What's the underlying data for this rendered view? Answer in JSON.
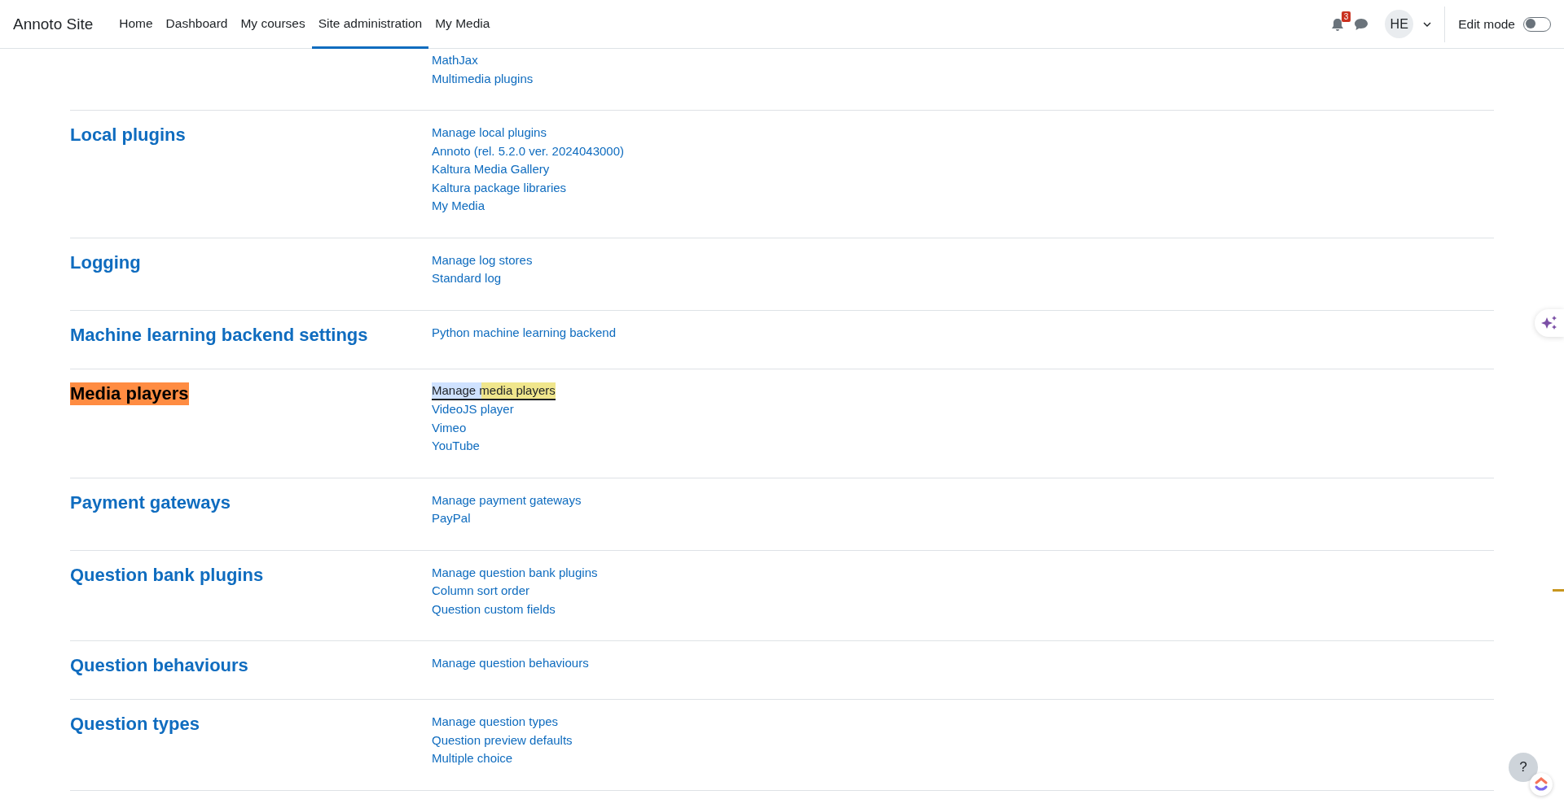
{
  "navbar": {
    "brand": "Annoto Site",
    "items": [
      {
        "label": "Home",
        "selected": false
      },
      {
        "label": "Dashboard",
        "selected": false
      },
      {
        "label": "My courses",
        "selected": false
      },
      {
        "label": "Site administration",
        "selected": true
      },
      {
        "label": "My Media",
        "selected": false
      }
    ],
    "notification_count": "3",
    "avatar": "HE",
    "edit_mode": {
      "label": "Edit mode",
      "on": false
    }
  },
  "sections": [
    {
      "links": [
        {
          "label": "MathJax",
          "highlighted": false
        },
        {
          "label": "Multimedia plugins",
          "highlighted": false
        }
      ]
    },
    {
      "heading": "Local plugins",
      "highlighted": false,
      "links": [
        {
          "label": "Manage local plugins",
          "highlighted": false
        },
        {
          "label": "Annoto (rel. 5.2.0 ver. 2024043000)",
          "highlighted": false
        },
        {
          "label": "Kaltura Media Gallery",
          "highlighted": false
        },
        {
          "label": "Kaltura package libraries",
          "highlighted": false
        },
        {
          "label": "My Media",
          "highlighted": false
        }
      ]
    },
    {
      "heading": "Logging",
      "highlighted": false,
      "links": [
        {
          "label": "Manage log stores",
          "highlighted": false
        },
        {
          "label": "Standard log",
          "highlighted": false
        }
      ]
    },
    {
      "heading": "Machine learning backend settings",
      "highlighted": false,
      "links": [
        {
          "label": "Python machine learning backend",
          "highlighted": false
        }
      ]
    },
    {
      "heading": "Media players",
      "highlighted": true,
      "links": [
        {
          "label": "Manage media players",
          "highlighted": true
        },
        {
          "label": "VideoJS player",
          "highlighted": false
        },
        {
          "label": "Vimeo",
          "highlighted": false
        },
        {
          "label": "YouTube",
          "highlighted": false
        }
      ]
    },
    {
      "heading": "Payment gateways",
      "highlighted": false,
      "links": [
        {
          "label": "Manage payment gateways",
          "highlighted": false
        },
        {
          "label": "PayPal",
          "highlighted": false
        }
      ]
    },
    {
      "heading": "Question bank plugins",
      "highlighted": false,
      "links": [
        {
          "label": "Manage question bank plugins",
          "highlighted": false
        },
        {
          "label": "Column sort order",
          "highlighted": false
        },
        {
          "label": "Question custom fields",
          "highlighted": false
        }
      ]
    },
    {
      "heading": "Question behaviours",
      "highlighted": false,
      "links": [
        {
          "label": "Manage question behaviours",
          "highlighted": false
        }
      ]
    },
    {
      "heading": "Question types",
      "highlighted": false,
      "links": [
        {
          "label": "Manage question types",
          "highlighted": false
        },
        {
          "label": "Question preview defaults",
          "highlighted": false
        },
        {
          "label": "Multiple choice",
          "highlighted": false
        }
      ]
    }
  ],
  "help_button": "?"
}
